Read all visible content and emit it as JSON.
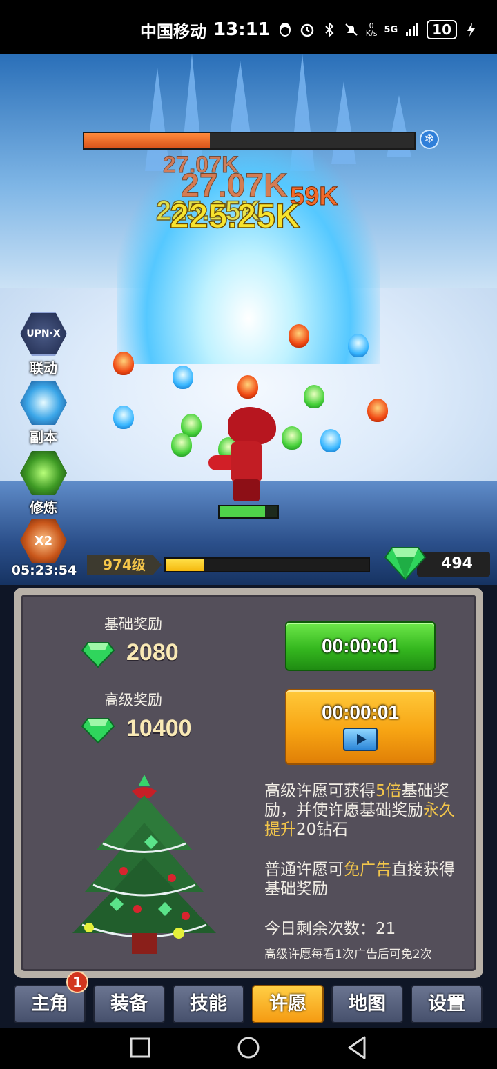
{
  "status_bar": {
    "carrier": "中国移动",
    "time": "13:11",
    "net_speed_value": "0",
    "net_speed_unit": "K/s",
    "network": "5G",
    "battery": "10"
  },
  "battle": {
    "boss_hp_fraction": 0.38,
    "damage_numbers": [
      "27.07K",
      "27.07K",
      "59K",
      "225.25K",
      "225.25K"
    ],
    "hero_hp_fraction": 0.78
  },
  "side_menu": [
    {
      "label": "联动",
      "icon": "link-icon"
    },
    {
      "label": "副本",
      "icon": "portal-icon"
    },
    {
      "label": "修炼",
      "icon": "training-icon"
    },
    {
      "label": "X2",
      "icon": "double-reward-icon"
    }
  ],
  "boost_timer": "05:23:54",
  "level": {
    "label": "974级",
    "xp_fraction": 0.19
  },
  "gems": {
    "count": "494"
  },
  "wish_panel": {
    "basic": {
      "title": "基础奖励",
      "amount": "2080",
      "button_timer": "00:00:01"
    },
    "advanced": {
      "title": "高级奖励",
      "amount": "10400",
      "button_timer": "00:00:01"
    },
    "desc1_parts": [
      "高级许愿可获得",
      "5倍",
      "基础奖励，并使许愿基础奖励",
      "永久提升",
      "20钻石"
    ],
    "desc2_parts": [
      "普通许愿可",
      "免广告",
      "直接获得基础奖励"
    ],
    "remaining": "今日剩余次数：21",
    "note": "高级许愿每看1次广告后可免2次"
  },
  "tabs": [
    {
      "label": "主角"
    },
    {
      "label": "装备"
    },
    {
      "label": "技能"
    },
    {
      "label": "许愿",
      "active": true
    },
    {
      "label": "地图"
    },
    {
      "label": "设置"
    }
  ],
  "tab_badge": "1",
  "colors": {
    "accent": "#f59b12",
    "green": "#35b81f",
    "highlight": "#f3c64a"
  }
}
